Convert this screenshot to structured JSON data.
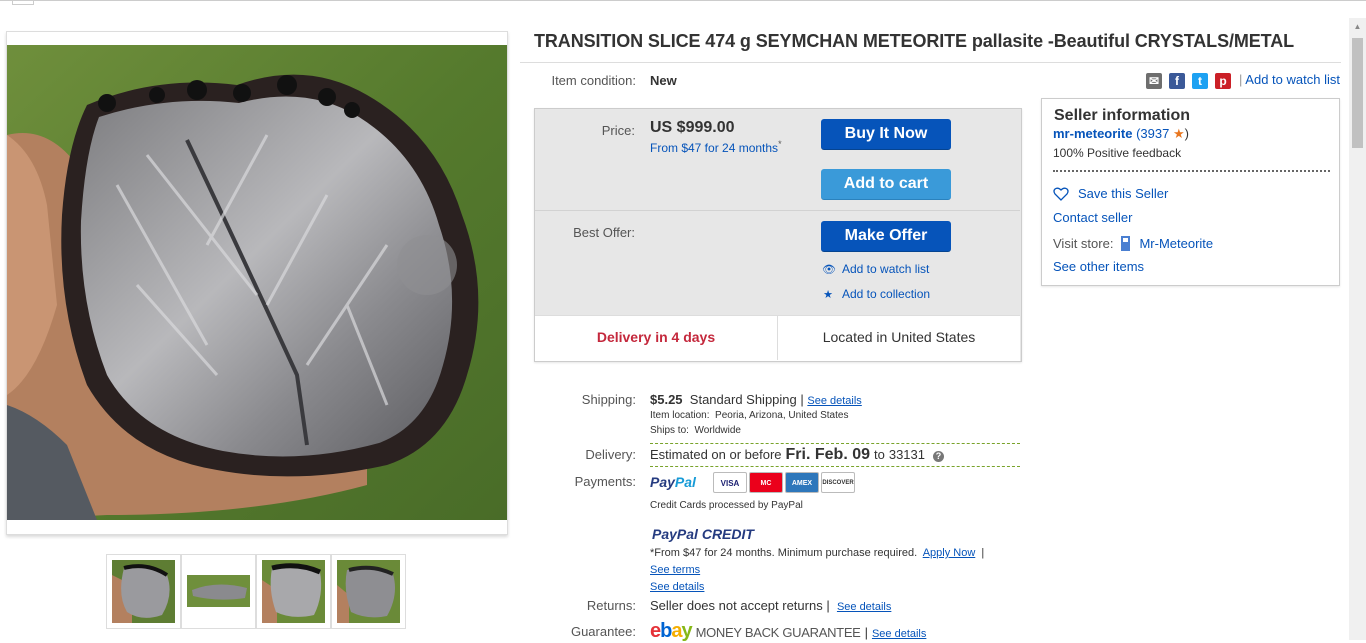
{
  "listing": {
    "title": "TRANSITION SLICE 474 g SEYMCHAN METEORITE pallasite -Beautiful CRYSTALS/METAL",
    "condition_label": "Item condition:",
    "condition_value": "New",
    "add_to_watch_list": "Add to watch list"
  },
  "purchase": {
    "price_label": "Price:",
    "price": "US $999.00",
    "financing": "From $47 for 24 months",
    "financing_mark": "*",
    "buy_now": "Buy It Now",
    "add_to_cart": "Add to cart",
    "best_offer_label": "Best Offer:",
    "make_offer": "Make Offer",
    "add_to_watch_list": "Add to watch list",
    "add_to_collection": "Add to collection",
    "delivery_days": "Delivery in 4 days",
    "located": "Located in United States"
  },
  "seller": {
    "heading": "Seller information",
    "name": "mr-meteorite",
    "feedback_open": "(3937",
    "feedback_close": ")",
    "positive": "100% Positive feedback",
    "save_seller": "Save this Seller",
    "contact": "Contact seller",
    "visit_store_label": "Visit store:",
    "store_name": "Mr-Meteorite",
    "other_items": "See other items"
  },
  "shipping": {
    "label": "Shipping:",
    "cost": "$5.25",
    "service": "Standard Shipping |",
    "see_details": "See details",
    "item_location_label": "Item location:",
    "item_location": "Peoria, Arizona, United States",
    "ships_to_label": "Ships to:",
    "ships_to": "Worldwide"
  },
  "delivery": {
    "label": "Delivery:",
    "prefix": "Estimated on or before",
    "date": "Fri. Feb. 09",
    "to": "to",
    "zip": "33131"
  },
  "payments": {
    "label": "Payments:",
    "paypal_a": "Pay",
    "paypal_b": "Pal",
    "cards": [
      "VISA",
      "MC",
      "AMEX",
      "DISCOVER"
    ],
    "credit_note": "Credit Cards processed by PayPal",
    "ppc_a": "PayPal",
    "ppc_b": "CREDIT",
    "ppc_note": "*From $47 for 24 months. Minimum purchase required.",
    "apply_now": "Apply Now",
    "pipe": "|",
    "see_terms": "See terms",
    "see_details": "See details"
  },
  "returns": {
    "label": "Returns:",
    "value": "Seller does not accept returns |",
    "see_details": "See details"
  },
  "guarantee": {
    "label": "Guarantee:",
    "ebay": "ebay",
    "mbg": "MONEY BACK GUARANTEE",
    "pipe": "|",
    "see_details": "See details"
  },
  "share_icons": [
    "email-icon",
    "facebook-icon",
    "twitter-icon",
    "pinterest-icon"
  ],
  "colors": {
    "accent": "#0654ba",
    "cart": "#3a9ad9",
    "delivery_red": "#c4283c",
    "star": "#e8761f"
  }
}
